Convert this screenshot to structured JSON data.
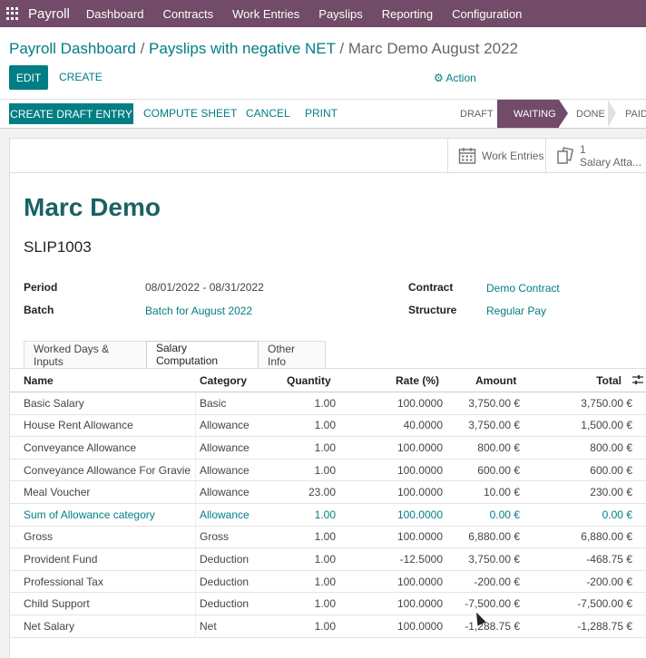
{
  "navbar": {
    "brand": "Payroll",
    "items": [
      "Dashboard",
      "Contracts",
      "Work Entries",
      "Payslips",
      "Reporting",
      "Configuration"
    ]
  },
  "breadcrumb": {
    "crumb1": "Payroll Dashboard",
    "sep": " / ",
    "crumb2": "Payslips with negative NET",
    "current": "Marc Demo August 2022"
  },
  "toolbar": {
    "edit_label": "EDIT",
    "create_label": "CREATE",
    "action_label": "Action"
  },
  "header_buttons": {
    "draft_entry": "CREATE DRAFT ENTRY",
    "compute": "COMPUTE SHEET",
    "cancel": "CANCEL",
    "print": "PRINT"
  },
  "statusbar": {
    "stages": [
      "DRAFT",
      "WAITING",
      "DONE",
      "PAID"
    ],
    "active": "WAITING"
  },
  "smart_buttons": {
    "work_entries": "Work Entries",
    "salary_count": "1",
    "salary_label": "Salary Atta..."
  },
  "record": {
    "name": "Marc Demo",
    "reference": "SLIP1003",
    "period_label": "Period",
    "period_value": "08/01/2022 - 08/31/2022",
    "batch_label": "Batch",
    "batch_value": "Batch for August 2022",
    "contract_label": "Contract",
    "contract_value": "Demo Contract",
    "structure_label": "Structure",
    "structure_value": "Regular Pay"
  },
  "tabs": [
    "Worked Days & Inputs",
    "Salary Computation",
    "Other Info"
  ],
  "table": {
    "headers": {
      "name": "Name",
      "category": "Category",
      "quantity": "Quantity",
      "rate": "Rate (%)",
      "amount": "Amount",
      "total": "Total"
    },
    "rows": [
      {
        "name": "Basic Salary",
        "category": "Basic",
        "quantity": "1.00",
        "rate": "100.0000",
        "amount": "3,750.00 €",
        "total": "3,750.00 €"
      },
      {
        "name": "House Rent Allowance",
        "category": "Allowance",
        "quantity": "1.00",
        "rate": "40.0000",
        "amount": "3,750.00 €",
        "total": "1,500.00 €"
      },
      {
        "name": "Conveyance Allowance",
        "category": "Allowance",
        "quantity": "1.00",
        "rate": "100.0000",
        "amount": "800.00 €",
        "total": "800.00 €"
      },
      {
        "name": "Conveyance Allowance For Gravie",
        "category": "Allowance",
        "quantity": "1.00",
        "rate": "100.0000",
        "amount": "600.00 €",
        "total": "600.00 €"
      },
      {
        "name": "Meal Voucher",
        "category": "Allowance",
        "quantity": "23.00",
        "rate": "100.0000",
        "amount": "10.00 €",
        "total": "230.00 €"
      },
      {
        "name": "Sum of Allowance category",
        "category": "Allowance",
        "quantity": "1.00",
        "rate": "100.0000",
        "amount": "0.00 €",
        "total": "0.00 €"
      },
      {
        "name": "Gross",
        "category": "Gross",
        "quantity": "1.00",
        "rate": "100.0000",
        "amount": "6,880.00 €",
        "total": "6,880.00 €"
      },
      {
        "name": "Provident Fund",
        "category": "Deduction",
        "quantity": "1.00",
        "rate": "-12.5000",
        "amount": "3,750.00 €",
        "total": "-468.75 €"
      },
      {
        "name": "Professional Tax",
        "category": "Deduction",
        "quantity": "1.00",
        "rate": "100.0000",
        "amount": "-200.00 €",
        "total": "-200.00 €"
      },
      {
        "name": "Child Support",
        "category": "Deduction",
        "quantity": "1.00",
        "rate": "100.0000",
        "amount": "-7,500.00 €",
        "total": "-7,500.00 €"
      },
      {
        "name": "Net Salary",
        "category": "Net",
        "quantity": "1.00",
        "rate": "100.0000",
        "amount": "-1,288.75 €",
        "total": "-1,288.75 €"
      }
    ]
  },
  "colors": {
    "brand": "#714b67",
    "accent": "#017e84"
  }
}
